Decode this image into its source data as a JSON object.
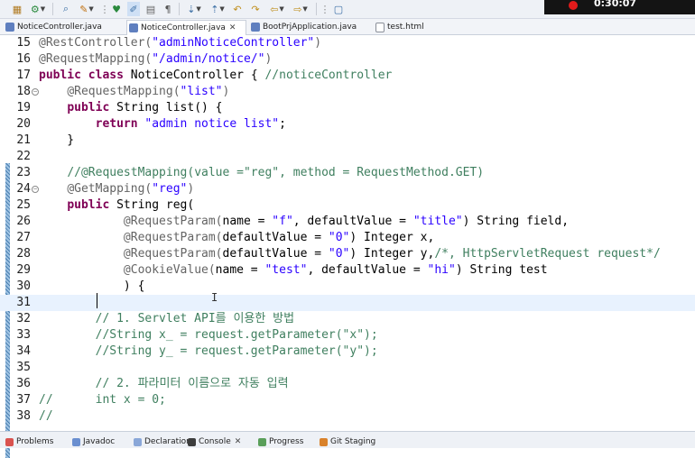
{
  "recording": {
    "timer": "0:30:07"
  },
  "toolbar": {
    "icons": [
      "new-icon",
      "run-icon",
      "debug-icon",
      "search-icon",
      "pin-icon",
      "toggle-mark-icon",
      "pen-icon",
      "pilcrow-icon",
      "next-annotation-icon",
      "prev-annotation-icon",
      "back-icon",
      "forward-icon",
      "nav-back-icon",
      "nav-forward-icon",
      "new-window-icon"
    ],
    "glyphs": {
      "pilcrow": "¶"
    }
  },
  "tabs": [
    {
      "label": "NoticeController.java",
      "icon": "java-file-icon",
      "active": false
    },
    {
      "label": "NoticeController.java",
      "icon": "java-file-icon",
      "active": true
    },
    {
      "label": "BootPrjApplication.java",
      "icon": "java-file-icon",
      "active": false
    },
    {
      "label": "test.html",
      "icon": "html-file-icon",
      "active": false
    }
  ],
  "editor": {
    "current_line": "31",
    "lines": [
      {
        "no": "15",
        "text": "@RestController(\"adminNoticeController\")"
      },
      {
        "no": "16",
        "text": "@RequestMapping(\"/admin/notice/\")"
      },
      {
        "no": "17",
        "text": "public class NoticeController { //noticeController"
      },
      {
        "no": "18",
        "text": "    @RequestMapping(\"list\")"
      },
      {
        "no": "19",
        "text": "    public String list() {"
      },
      {
        "no": "20",
        "text": "        return \"admin notice list\";"
      },
      {
        "no": "21",
        "text": "    }"
      },
      {
        "no": "22",
        "text": ""
      },
      {
        "no": "23",
        "text": "    //@RequestMapping(value =\"reg\", method = RequestMethod.GET)"
      },
      {
        "no": "24",
        "text": "    @GetMapping(\"reg\")"
      },
      {
        "no": "25",
        "text": "    public String reg("
      },
      {
        "no": "26",
        "text": "            @RequestParam(name = \"f\", defaultValue = \"title\") String field,"
      },
      {
        "no": "27",
        "text": "            @RequestParam(defaultValue = \"0\") Integer x,"
      },
      {
        "no": "28",
        "text": "            @RequestParam(defaultValue = \"0\") Integer y,/*, HttpServletRequest request*/"
      },
      {
        "no": "29",
        "text": "            @CookieValue(name = \"test\", defaultValue = \"hi\") String test"
      },
      {
        "no": "30",
        "text": "            ) {"
      },
      {
        "no": "31",
        "text": ""
      },
      {
        "no": "32",
        "text": "        // 1. Servlet API를 이용한 방법"
      },
      {
        "no": "33",
        "text": "        //String x_ = request.getParameter(\"x\");"
      },
      {
        "no": "34",
        "text": "        //String y_ = request.getParameter(\"y\");"
      },
      {
        "no": "35",
        "text": ""
      },
      {
        "no": "36",
        "text": "        // 2. 파라미터 이름으로 자동 입력"
      },
      {
        "no": "37",
        "text": "//      int x = 0;"
      },
      {
        "no": "38",
        "text": "//"
      }
    ]
  },
  "bottom_tabs": [
    {
      "label": "Problems",
      "icon": "problems-icon"
    },
    {
      "label": "Javadoc",
      "icon": "javadoc-icon"
    },
    {
      "label": "Declaration",
      "icon": "declaration-icon"
    },
    {
      "label": "Console",
      "icon": "console-icon"
    },
    {
      "label": "Progress",
      "icon": "progress-icon"
    },
    {
      "label": "Git Staging",
      "icon": "git-staging-icon"
    }
  ],
  "colors": {
    "keyword": "#7f0055",
    "annotation": "#646464",
    "string": "#2a00ff",
    "comment": "#3f7f5f",
    "current_line": "#e8f2fe"
  }
}
